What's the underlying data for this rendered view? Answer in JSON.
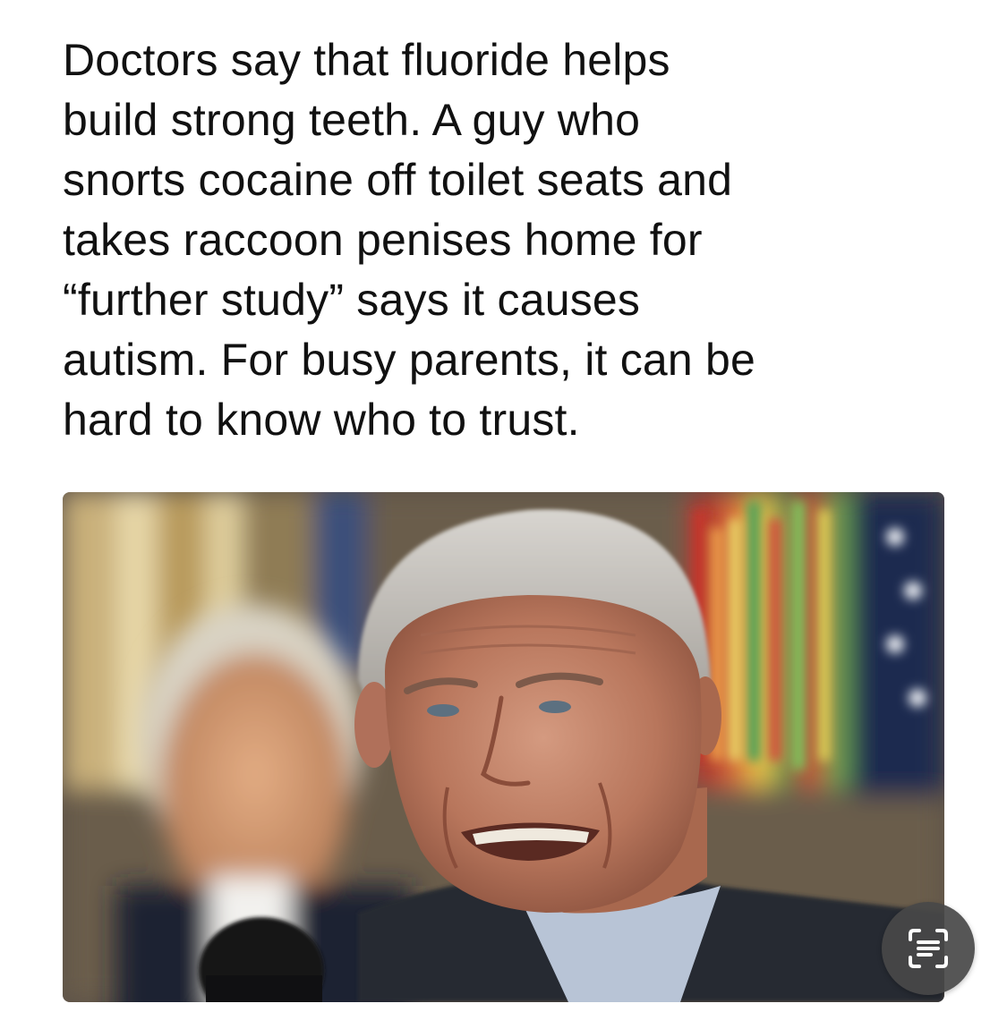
{
  "post": {
    "lines": [
      "Doctors say that fluoride helps",
      "build strong teeth. A guy who",
      "snorts cocaine off toilet seats and",
      "takes raccoon penises home for",
      "“further study” says it causes",
      "autism. For busy parents, it can be",
      "hard to know who to trust."
    ]
  },
  "photo": {
    "content": "news-photo"
  },
  "live_text_button": {
    "icon": "live-text-icon",
    "icon_color": "#ffffff",
    "background": "#484848"
  }
}
